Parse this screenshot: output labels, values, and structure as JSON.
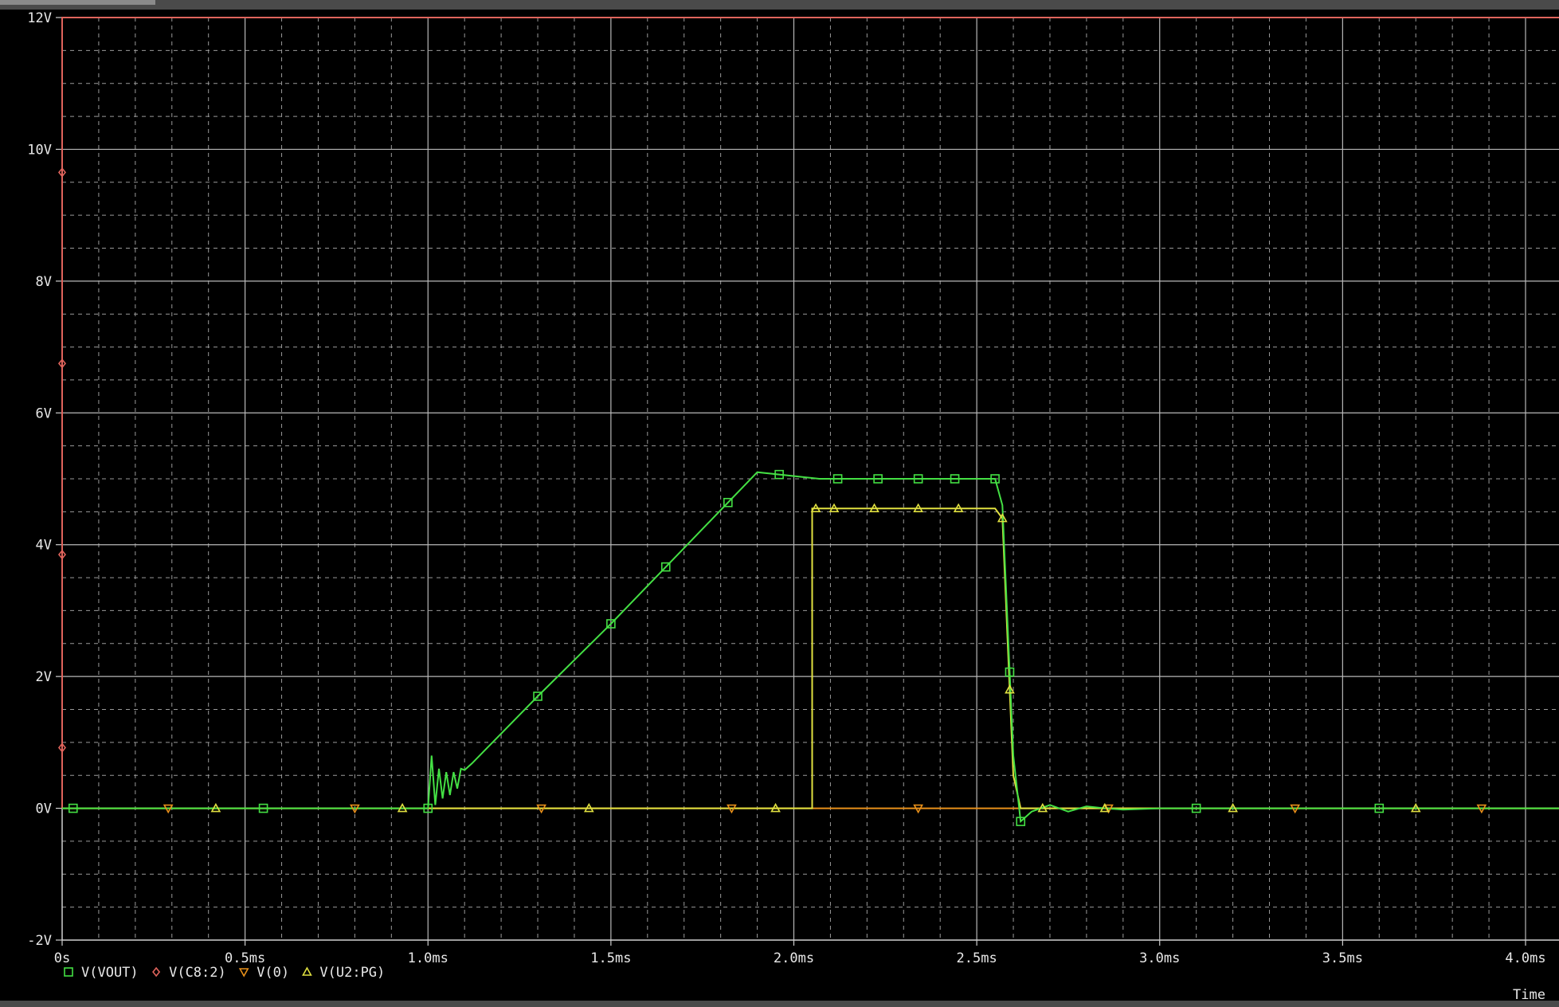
{
  "chart_data": {
    "type": "line",
    "title": "",
    "xlabel": "Time",
    "ylabel": "",
    "xlim": [
      0,
      4.0
    ],
    "ylim": [
      -2,
      12
    ],
    "x_ticks": [
      0,
      0.5,
      1.0,
      1.5,
      2.0,
      2.5,
      3.0,
      3.5,
      4.0
    ],
    "x_tick_labels": [
      "0s",
      "0.5ms",
      "1.0ms",
      "1.5ms",
      "2.0ms",
      "2.5ms",
      "3.0ms",
      "3.5ms",
      "4.0ms"
    ],
    "y_ticks": [
      -2,
      0,
      2,
      4,
      6,
      8,
      10,
      12
    ],
    "y_tick_labels": [
      "-2V",
      "0V",
      "2V",
      "4V",
      "6V",
      "8V",
      "10V",
      "12V"
    ],
    "grid": true,
    "legend_position": "bottom-left",
    "background": "#000000",
    "series": [
      {
        "name": "V(VOUT)",
        "color": "#44e044",
        "marker": "square",
        "x": [
          0,
          1.0,
          1.01,
          1.02,
          1.03,
          1.04,
          1.05,
          1.06,
          1.07,
          1.08,
          1.09,
          1.1,
          1.12,
          1.15,
          1.3,
          1.5,
          1.7,
          1.9,
          2.07,
          2.1,
          2.3,
          2.55,
          2.57,
          2.6,
          2.62,
          2.65,
          2.7,
          2.75,
          2.8,
          2.85,
          2.9,
          3.0,
          3.2,
          3.5,
          4.1
        ],
        "y": [
          0,
          0,
          0.8,
          0.05,
          0.6,
          0.15,
          0.55,
          0.2,
          0.55,
          0.3,
          0.6,
          0.58,
          0.68,
          0.85,
          1.7,
          2.8,
          3.95,
          5.1,
          5.0,
          5.0,
          5.0,
          5.0,
          4.6,
          0.8,
          -0.2,
          -0.05,
          0.05,
          -0.05,
          0.03,
          0.0,
          -0.02,
          0,
          0,
          0,
          0
        ],
        "marker_x": [
          0.03,
          0.55,
          1.0,
          1.3,
          1.5,
          1.65,
          1.82,
          1.96,
          2.12,
          2.23,
          2.34,
          2.44,
          2.55,
          2.59,
          2.62,
          3.1,
          3.6
        ]
      },
      {
        "name": "V(C8:2)",
        "color": "#e0645c",
        "marker": "diamond",
        "x": [
          0,
          0.0001,
          4.1
        ],
        "y": [
          0,
          12,
          12
        ],
        "marker_points": [
          [
            0.0,
            9.65
          ],
          [
            0.0,
            6.75
          ],
          [
            0.0,
            3.85
          ],
          [
            0.0,
            0.92
          ]
        ]
      },
      {
        "name": "V(0)",
        "color": "#e8901a",
        "marker": "triangle-down",
        "x": [
          0,
          4.1
        ],
        "y": [
          0,
          0
        ],
        "marker_x": [
          0.29,
          0.8,
          1.31,
          1.83,
          2.34,
          2.86,
          3.37,
          3.88
        ]
      },
      {
        "name": "V(U2:PG)",
        "color": "#e0e040",
        "marker": "triangle-up",
        "x": [
          0,
          2.05,
          2.05,
          2.07,
          2.55,
          2.57,
          2.6,
          2.62,
          4.1
        ],
        "y": [
          0,
          0,
          4.55,
          4.55,
          4.55,
          4.4,
          0.5,
          0,
          0
        ],
        "marker_x": [
          0.42,
          0.93,
          1.44,
          1.95,
          2.06,
          2.11,
          2.22,
          2.34,
          2.45,
          2.57,
          2.59,
          2.68,
          2.85,
          3.2,
          3.7
        ]
      }
    ]
  },
  "legend": [
    {
      "symbol": "□",
      "color": "#44e044",
      "label": "V(VOUT)"
    },
    {
      "symbol": "◇",
      "color": "#e0645c",
      "label": "V(C8:2)"
    },
    {
      "symbol": "▽",
      "color": "#e8901a",
      "label": "V(0)"
    },
    {
      "symbol": "△",
      "color": "#e0e040",
      "label": "V(U2:PG)"
    }
  ]
}
